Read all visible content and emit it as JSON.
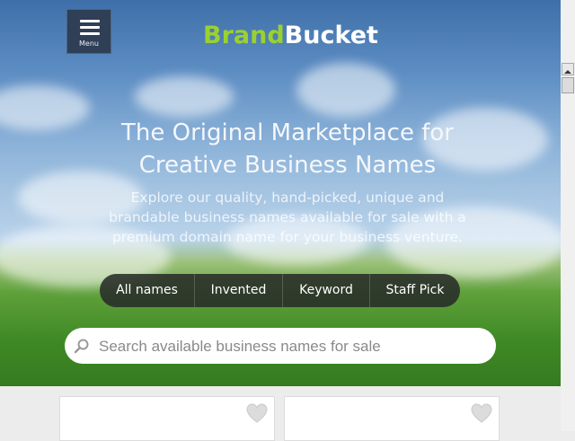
{
  "header": {
    "menu_label": "Menu",
    "logo_part1": "Brand",
    "logo_part2": "Bucket"
  },
  "hero": {
    "headline_line1": "The Original Marketplace for",
    "headline_line2": "Creative Business Names",
    "subtext": "Explore our quality, hand-picked, unique and brandable business names available for sale with a premium domain name for your business venture."
  },
  "tabs": [
    {
      "label": "All names"
    },
    {
      "label": "Invented"
    },
    {
      "label": "Keyword"
    },
    {
      "label": "Staff Pick"
    }
  ],
  "search": {
    "placeholder": "Search available business names for sale",
    "value": ""
  },
  "colors": {
    "logo_green": "#9bd12e",
    "menu_bg": "#2e3f56",
    "tab_bg": "#2c2f2c"
  },
  "icons": [
    "hamburger-icon",
    "search-icon",
    "heart-icon"
  ]
}
